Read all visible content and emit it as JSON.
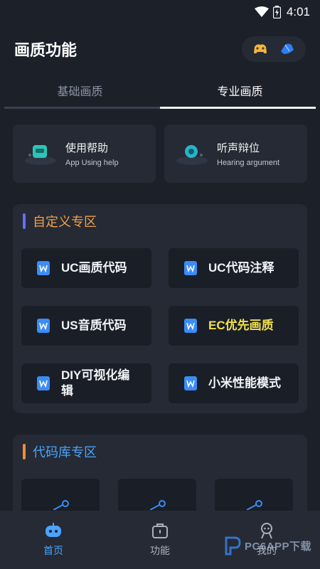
{
  "status": {
    "time": "4:01"
  },
  "header": {
    "title": "画质功能"
  },
  "tabs": [
    {
      "label": "基础画质",
      "active": false
    },
    {
      "label": "专业画质",
      "active": true
    }
  ],
  "help_cards": [
    {
      "title": "使用帮助",
      "subtitle": "App Using help",
      "icon": "help-robot-icon"
    },
    {
      "title": "听声辩位",
      "subtitle": "Hearing argument",
      "icon": "hearing-icon"
    }
  ],
  "custom_section": {
    "title": "自定义专区",
    "title_color": "#f0a04b",
    "bar_color": "#6b6cf2",
    "items": [
      {
        "label": "UC画质代码"
      },
      {
        "label": "UC代码注释"
      },
      {
        "label": "US音质代码"
      },
      {
        "label": "EC优先画质",
        "highlight": "#f2e14a"
      },
      {
        "label": "DIY可视化编辑"
      },
      {
        "label": "小米性能模式"
      }
    ]
  },
  "library_section": {
    "title": "代码库专区",
    "title_color": "#4aa3ff",
    "bar_color": "#f08a3c"
  },
  "nav": [
    {
      "label": "首页",
      "icon": "robot-home-icon",
      "active": true
    },
    {
      "label": "功能",
      "icon": "toolbox-icon",
      "active": false
    },
    {
      "label": "我的",
      "icon": "profile-icon",
      "active": false
    }
  ],
  "watermark": {
    "text": "PC6APP下载"
  },
  "colors": {
    "background": "#1c2029",
    "card": "#252a34",
    "accent": "#4aa3ff"
  }
}
